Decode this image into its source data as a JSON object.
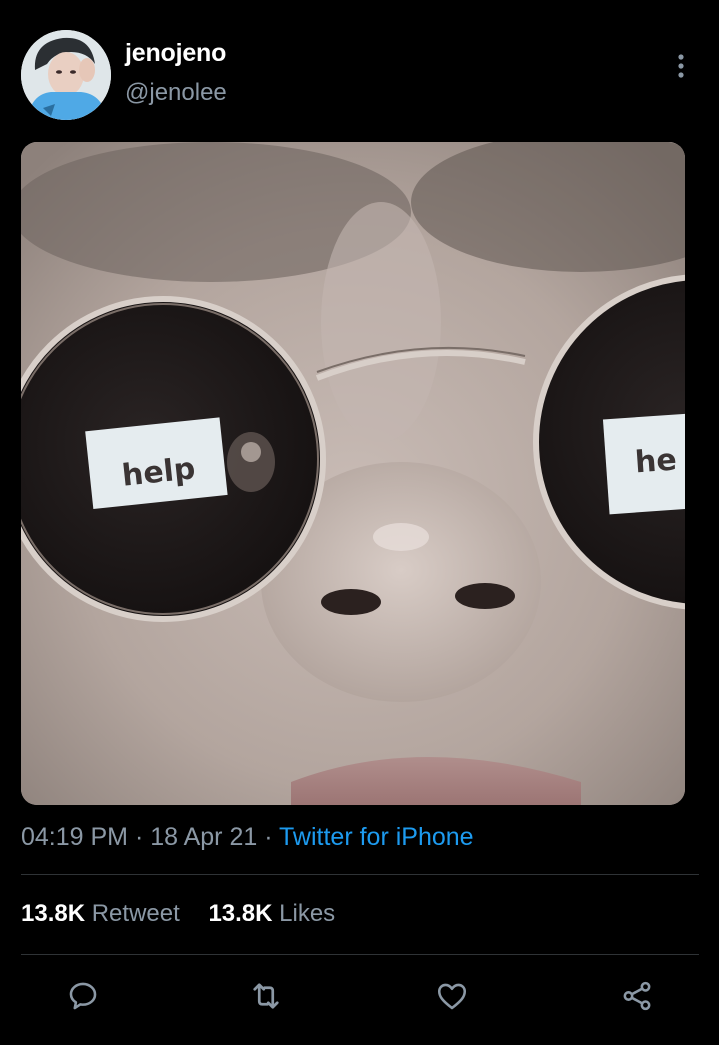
{
  "author": {
    "display_name": "jenojeno",
    "handle": "@jenolee"
  },
  "photo": {
    "lens_text_left": "help",
    "lens_text_right": "he"
  },
  "meta": {
    "time": "04:19 PM",
    "separator": " · ",
    "date": "18 Apr 21",
    "source": "Twitter for iPhone"
  },
  "stats": {
    "retweets_count": "13.8K",
    "retweets_label": "Retweet",
    "likes_count": "13.8K",
    "likes_label": "Likes"
  },
  "colors": {
    "background": "#000000",
    "secondary_text": "#8b98a5",
    "accent": "#1d9bf0",
    "divider": "#2f3336"
  },
  "icons": {
    "more": "more-vertical-icon",
    "reply": "reply-icon",
    "retweet": "retweet-icon",
    "like": "heart-icon",
    "share": "share-icon"
  }
}
